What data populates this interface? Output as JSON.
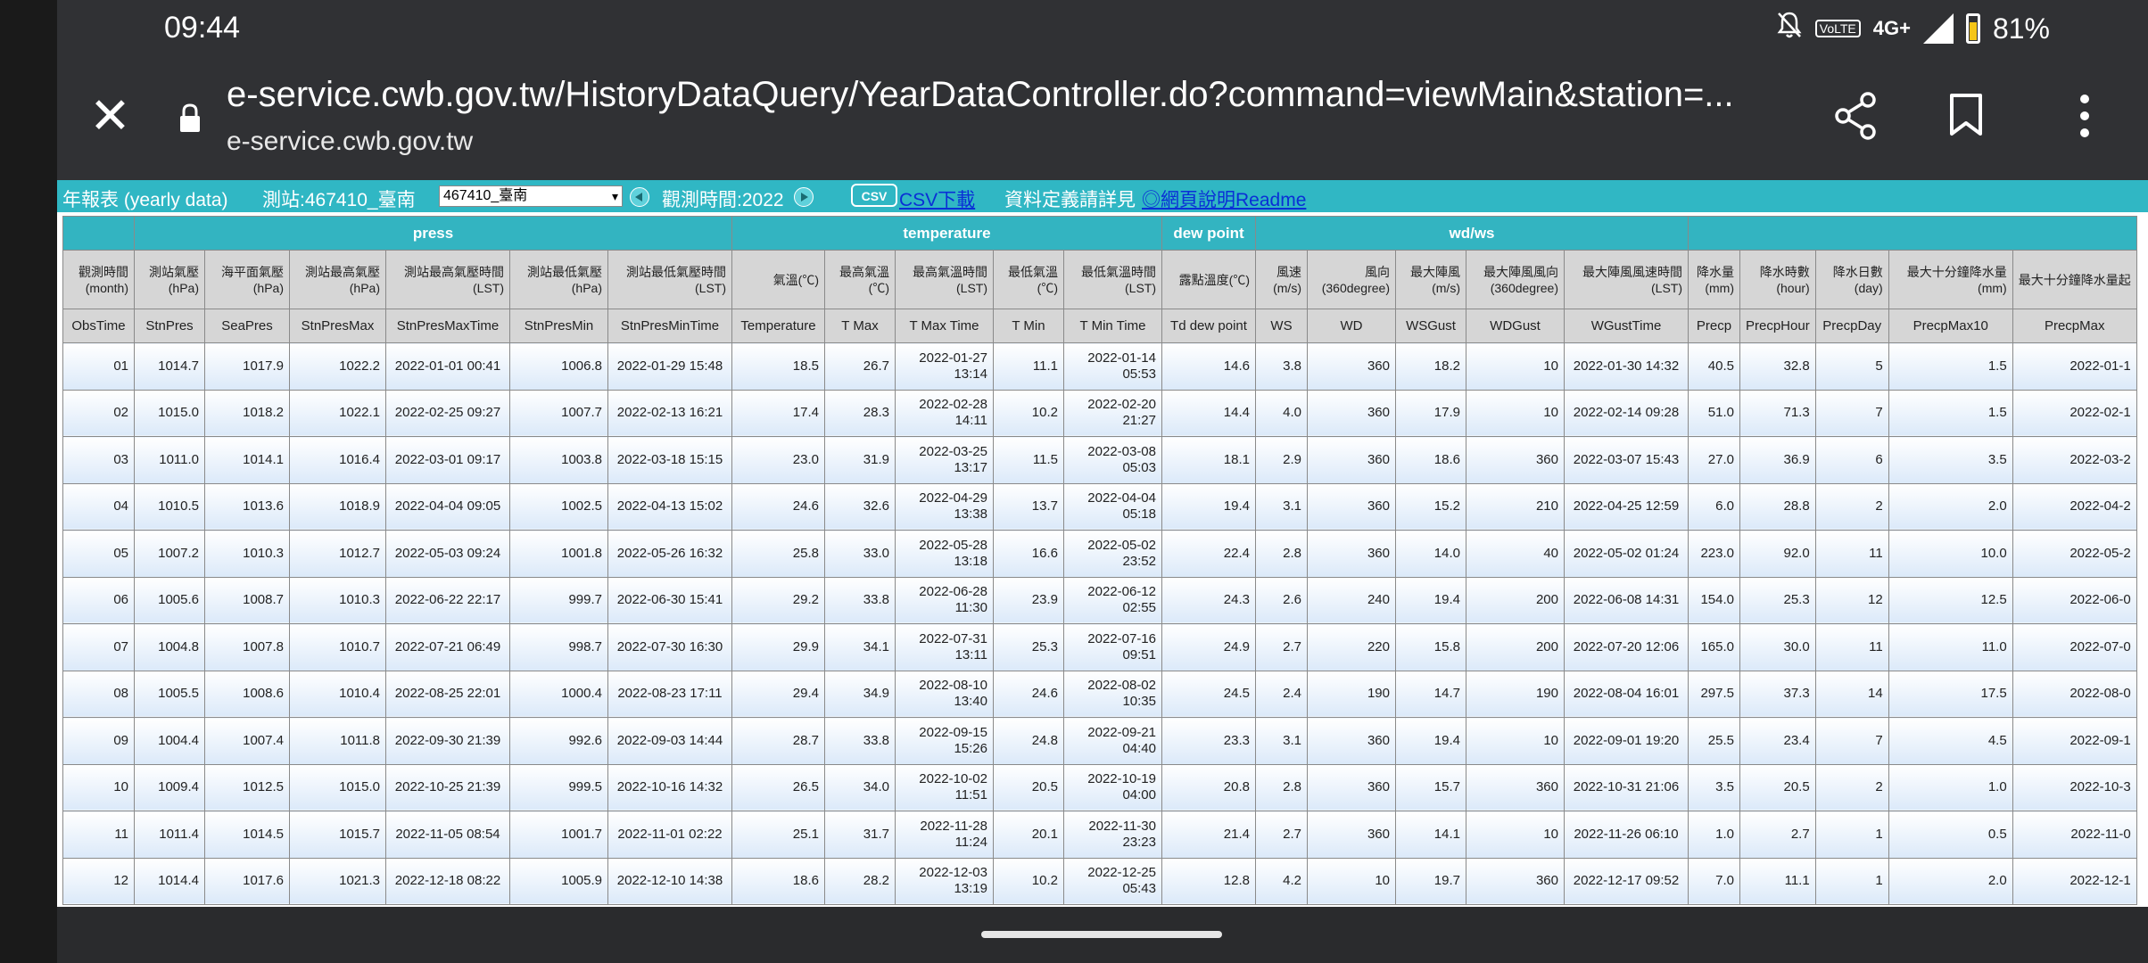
{
  "status": {
    "time": "09:44",
    "net": "4G+",
    "lte": "VoLTE",
    "battery": "81%"
  },
  "url": {
    "full": "e-service.cwb.gov.tw/HistoryDataQuery/YearDataController.do?command=viewMain&station=...",
    "domain": "e-service.cwb.gov.tw"
  },
  "toolbar": {
    "title": "年報表 (yearly data)",
    "station_label": "測站:467410_臺南",
    "station_selected": "467410_臺南",
    "time_label": "觀測時間:2022",
    "csv_icon": "CSV",
    "csv_link": "CSV下載",
    "def_text": "資料定義請詳見",
    "readme_link": "◎網頁說明Readme"
  },
  "table": {
    "groups": [
      "press",
      "temperature",
      "dew point",
      "wd/ws"
    ],
    "zh_headers": [
      "觀測時間(month)",
      "測站氣壓(hPa)",
      "海平面氣壓(hPa)",
      "測站最高氣壓(hPa)",
      "測站最高氣壓時間(LST)",
      "測站最低氣壓(hPa)",
      "測站最低氣壓時間(LST)",
      "氣溫(℃)",
      "最高氣溫(℃)",
      "最高氣溫時間(LST)",
      "最低氣溫(℃)",
      "最低氣溫時間(LST)",
      "露點溫度(℃)",
      "風速(m/s)",
      "風向(360degree)",
      "最大陣風(m/s)",
      "最大陣風風向(360degree)",
      "最大陣風風速時間(LST)",
      "降水量(mm)",
      "降水時數(hour)",
      "降水日數(day)",
      "最大十分鐘降水量(mm)",
      "最大十分鐘降水量起"
    ],
    "en_headers": [
      "ObsTime",
      "StnPres",
      "SeaPres",
      "StnPresMax",
      "StnPresMaxTime",
      "StnPresMin",
      "StnPresMinTime",
      "Temperature",
      "T Max",
      "T Max Time",
      "T Min",
      "T Min Time",
      "Td dew point",
      "WS",
      "WD",
      "WSGust",
      "WDGust",
      "WGustTime",
      "Precp",
      "PrecpHour",
      "PrecpDay",
      "PrecpMax10",
      "PrecpMax"
    ],
    "rows": [
      [
        "01",
        "1014.7",
        "1017.9",
        "1022.2",
        "2022-01-01 00:41",
        "1006.8",
        "2022-01-29 15:48",
        "18.5",
        "26.7",
        "2022-01-27 13:14",
        "11.1",
        "2022-01-14 05:53",
        "14.6",
        "3.8",
        "360",
        "18.2",
        "10",
        "2022-01-30 14:32",
        "40.5",
        "32.8",
        "5",
        "1.5",
        "2022-01-1"
      ],
      [
        "02",
        "1015.0",
        "1018.2",
        "1022.1",
        "2022-02-25 09:27",
        "1007.7",
        "2022-02-13 16:21",
        "17.4",
        "28.3",
        "2022-02-28 14:11",
        "10.2",
        "2022-02-20 21:27",
        "14.4",
        "4.0",
        "360",
        "17.9",
        "10",
        "2022-02-14 09:28",
        "51.0",
        "71.3",
        "7",
        "1.5",
        "2022-02-1"
      ],
      [
        "03",
        "1011.0",
        "1014.1",
        "1016.4",
        "2022-03-01 09:17",
        "1003.8",
        "2022-03-18 15:15",
        "23.0",
        "31.9",
        "2022-03-25 13:17",
        "11.5",
        "2022-03-08 05:03",
        "18.1",
        "2.9",
        "360",
        "18.6",
        "360",
        "2022-03-07 15:43",
        "27.0",
        "36.9",
        "6",
        "3.5",
        "2022-03-2"
      ],
      [
        "04",
        "1010.5",
        "1013.6",
        "1018.9",
        "2022-04-04 09:05",
        "1002.5",
        "2022-04-13 15:02",
        "24.6",
        "32.6",
        "2022-04-29 13:38",
        "13.7",
        "2022-04-04 05:18",
        "19.4",
        "3.1",
        "360",
        "15.2",
        "210",
        "2022-04-25 12:59",
        "6.0",
        "28.8",
        "2",
        "2.0",
        "2022-04-2"
      ],
      [
        "05",
        "1007.2",
        "1010.3",
        "1012.7",
        "2022-05-03 09:24",
        "1001.8",
        "2022-05-26 16:32",
        "25.8",
        "33.0",
        "2022-05-28 13:18",
        "16.6",
        "2022-05-02 23:52",
        "22.4",
        "2.8",
        "360",
        "14.0",
        "40",
        "2022-05-02 01:24",
        "223.0",
        "92.0",
        "11",
        "10.0",
        "2022-05-2"
      ],
      [
        "06",
        "1005.6",
        "1008.7",
        "1010.3",
        "2022-06-22 22:17",
        "999.7",
        "2022-06-30 15:41",
        "29.2",
        "33.8",
        "2022-06-28 11:30",
        "23.9",
        "2022-06-12 02:55",
        "24.3",
        "2.6",
        "240",
        "19.4",
        "200",
        "2022-06-08 14:31",
        "154.0",
        "25.3",
        "12",
        "12.5",
        "2022-06-0"
      ],
      [
        "07",
        "1004.8",
        "1007.8",
        "1010.7",
        "2022-07-21 06:49",
        "998.7",
        "2022-07-30 16:30",
        "29.9",
        "34.1",
        "2022-07-31 13:11",
        "25.3",
        "2022-07-16 09:51",
        "24.9",
        "2.7",
        "220",
        "15.8",
        "200",
        "2022-07-20 12:06",
        "165.0",
        "30.0",
        "11",
        "11.0",
        "2022-07-0"
      ],
      [
        "08",
        "1005.5",
        "1008.6",
        "1010.4",
        "2022-08-25 22:01",
        "1000.4",
        "2022-08-23 17:11",
        "29.4",
        "34.9",
        "2022-08-10 13:40",
        "24.6",
        "2022-08-02 10:35",
        "24.5",
        "2.4",
        "190",
        "14.7",
        "190",
        "2022-08-04 16:01",
        "297.5",
        "37.3",
        "14",
        "17.5",
        "2022-08-0"
      ],
      [
        "09",
        "1004.4",
        "1007.4",
        "1011.8",
        "2022-09-30 21:39",
        "992.6",
        "2022-09-03 14:44",
        "28.7",
        "33.8",
        "2022-09-15 15:26",
        "24.8",
        "2022-09-21 04:40",
        "23.3",
        "3.1",
        "360",
        "19.4",
        "10",
        "2022-09-01 19:20",
        "25.5",
        "23.4",
        "7",
        "4.5",
        "2022-09-1"
      ],
      [
        "10",
        "1009.4",
        "1012.5",
        "1015.0",
        "2022-10-25 21:39",
        "999.5",
        "2022-10-16 14:32",
        "26.5",
        "34.0",
        "2022-10-02 11:51",
        "20.5",
        "2022-10-19 04:00",
        "20.8",
        "2.8",
        "360",
        "15.7",
        "360",
        "2022-10-31 21:06",
        "3.5",
        "20.5",
        "2",
        "1.0",
        "2022-10-3"
      ],
      [
        "11",
        "1011.4",
        "1014.5",
        "1015.7",
        "2022-11-05 08:54",
        "1001.7",
        "2022-11-01 02:22",
        "25.1",
        "31.7",
        "2022-11-28 11:24",
        "20.1",
        "2022-11-30 23:23",
        "21.4",
        "2.7",
        "360",
        "14.1",
        "10",
        "2022-11-26 06:10",
        "1.0",
        "2.7",
        "1",
        "0.5",
        "2022-11-0"
      ],
      [
        "12",
        "1014.4",
        "1017.6",
        "1021.3",
        "2022-12-18 08:22",
        "1005.9",
        "2022-12-10 14:38",
        "18.6",
        "28.2",
        "2022-12-03 13:19",
        "10.2",
        "2022-12-25 05:43",
        "12.8",
        "4.2",
        "10",
        "19.7",
        "360",
        "2022-12-17 09:52",
        "7.0",
        "11.1",
        "1",
        "2.0",
        "2022-12-1"
      ]
    ]
  }
}
